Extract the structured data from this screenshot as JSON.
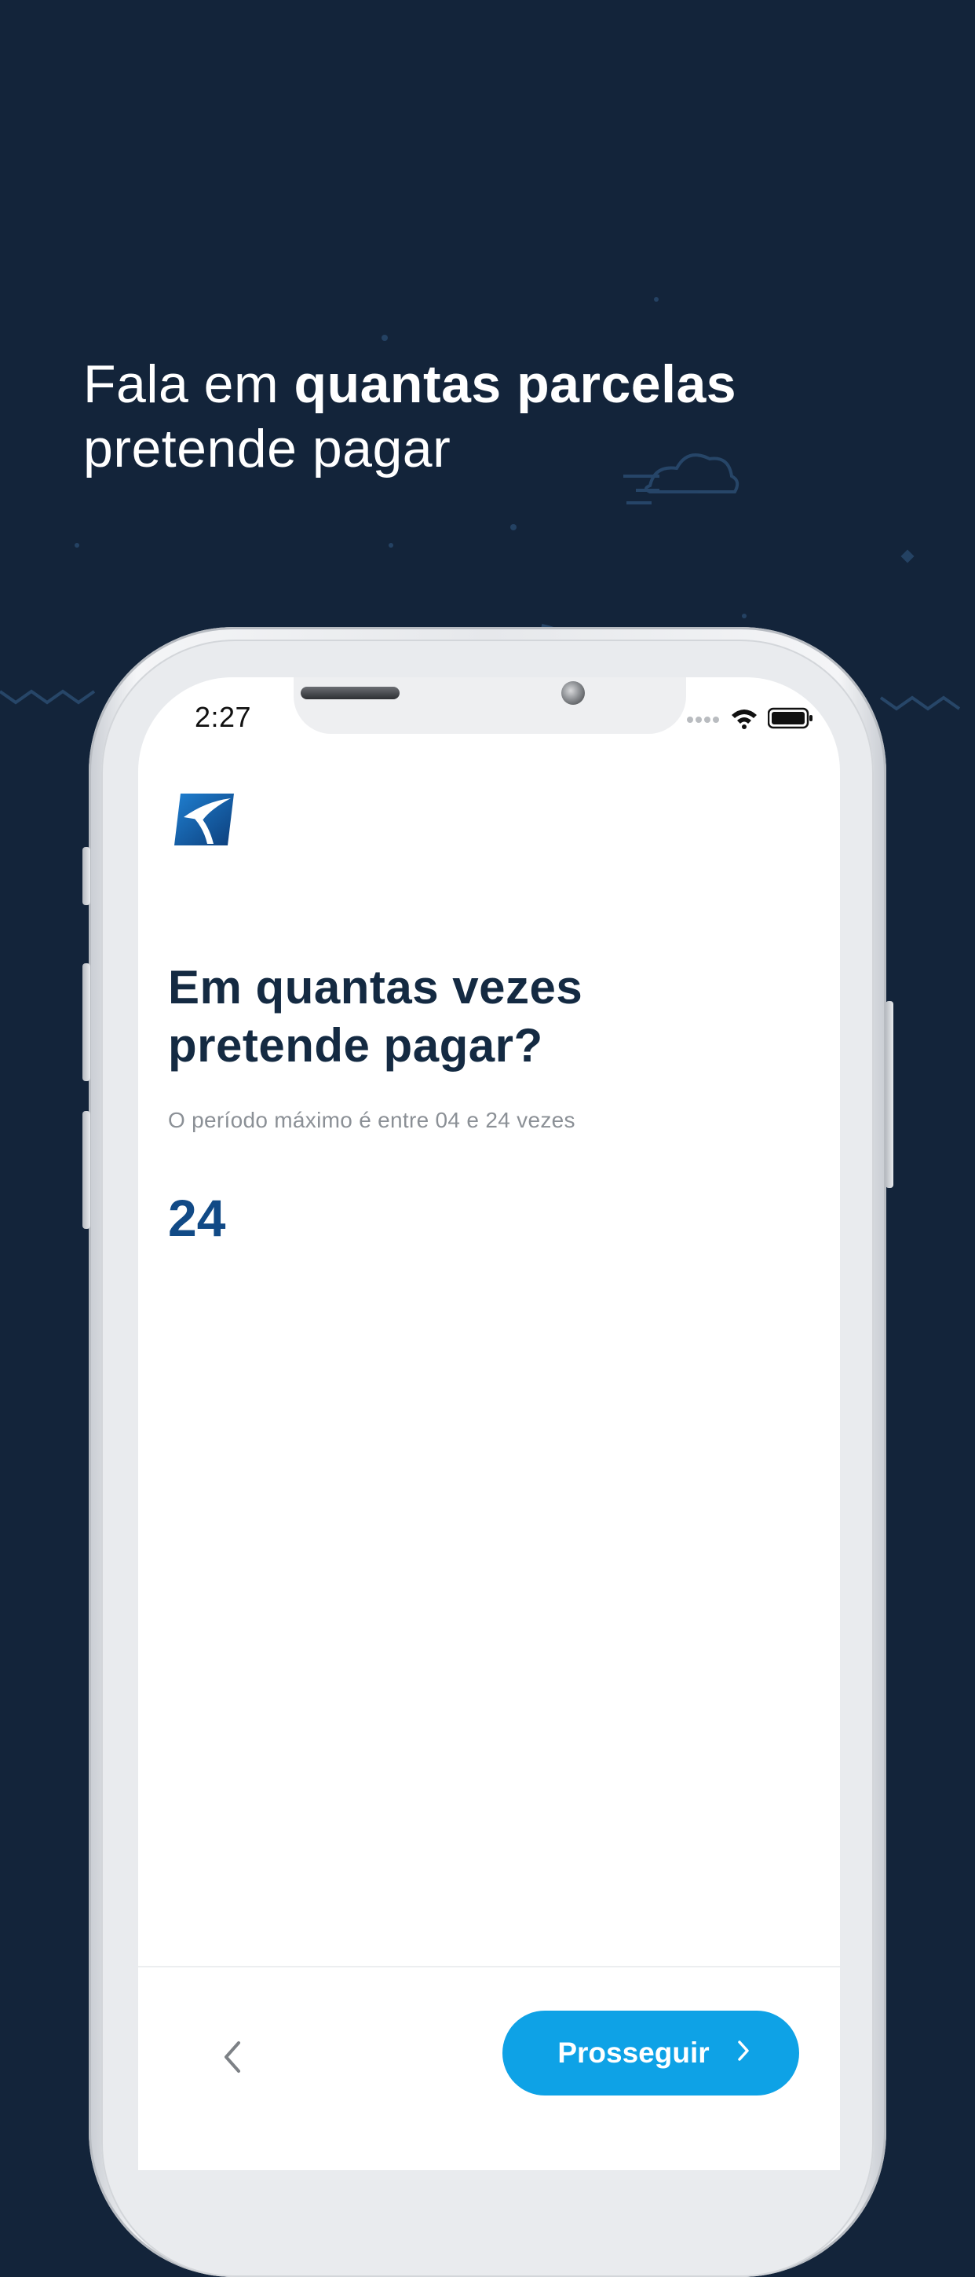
{
  "headline": {
    "part1": "Fala em ",
    "part2_bold": "quantas parcelas",
    "part3": "pretende pagar"
  },
  "status_bar": {
    "time": "2:27",
    "icons": [
      "signal-dots-icon",
      "wifi-icon",
      "battery-icon"
    ]
  },
  "app": {
    "logo": "bank-logo-icon",
    "question_line1": "Em quantas vezes",
    "question_line2": "pretende pagar?",
    "helper_text": "O período máximo é entre 04 e 24 vezes",
    "installments_value": "24"
  },
  "footer": {
    "back_icon": "chevron-left-icon",
    "proceed_label": "Prosseguir",
    "proceed_icon": "chevron-right-icon"
  },
  "colors": {
    "background": "#13243a",
    "heading": "#142a42",
    "value": "#114a86",
    "button": "#0ea2e6"
  }
}
